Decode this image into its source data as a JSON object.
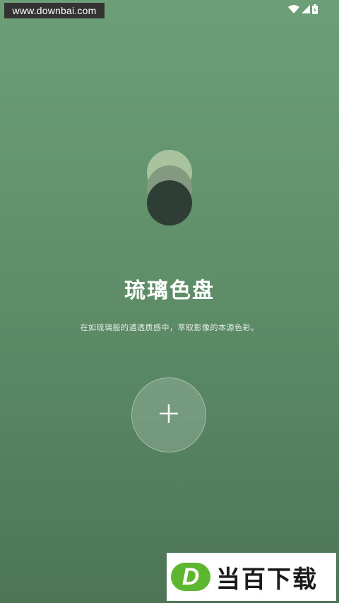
{
  "status_bar": {
    "watermark": "www.downbai.com",
    "icons": [
      "wifi-icon",
      "cellular-signal-icon",
      "battery-icon"
    ]
  },
  "app": {
    "title": "琉璃色盘",
    "subtitle": "在如琉璃般的通透质感中，萃取影像的本源色彩。",
    "add_label": "+"
  },
  "brand": {
    "logo_letter": "D",
    "name": "当百下载"
  },
  "colors": {
    "background_top": "#6c9f78",
    "background_bottom": "#4d7556",
    "logo_light": "#a9c39e",
    "logo_mid": "#849a80",
    "logo_dark": "#2f3e34",
    "brand_green": "#5cb630"
  }
}
